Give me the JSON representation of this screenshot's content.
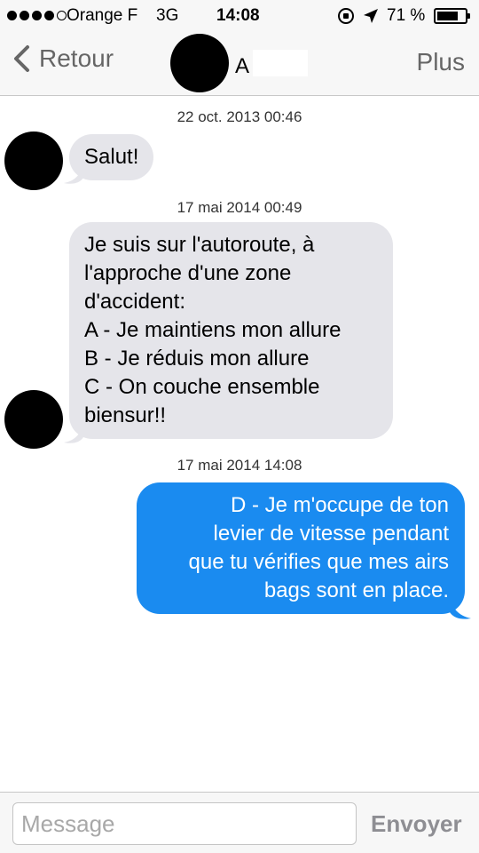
{
  "status_bar": {
    "carrier": "Orange F",
    "network": "3G",
    "time": "14:08",
    "battery": "71 %"
  },
  "nav": {
    "back_label": "Retour",
    "contact_name": "A",
    "more_label": "Plus"
  },
  "messages": [
    {
      "timestamp": "22 oct. 2013 00:46",
      "direction": "incoming",
      "lines": [
        "Salut!"
      ]
    },
    {
      "timestamp": "17 mai 2014 00:49",
      "direction": "incoming",
      "lines": [
        "Je suis sur l'autoroute, à",
        "l'approche d'une zone",
        "d'accident:",
        "A - Je maintiens mon allure",
        "B - Je réduis mon allure",
        "C - On couche ensemble",
        "biensur!!"
      ]
    },
    {
      "timestamp": "17 mai 2014 14:08",
      "direction": "outgoing",
      "lines": [
        "D - Je m'occupe de ton",
        "levier de vitesse pendant",
        "que tu vérifies que mes airs",
        "bags sont en place."
      ]
    }
  ],
  "input": {
    "placeholder": "Message",
    "value": "",
    "send_label": "Envoyer"
  },
  "colors": {
    "incoming_bubble": "#e5e5ea",
    "outgoing_bubble": "#1a8bf0",
    "nav_tint": "#666666",
    "send_disabled": "#8e8e93"
  }
}
